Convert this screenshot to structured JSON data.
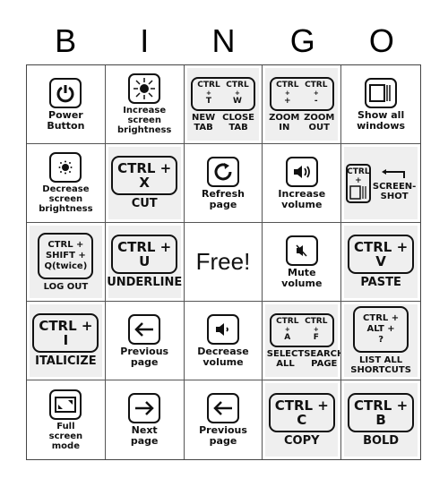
{
  "header": [
    "B",
    "I",
    "N",
    "G",
    "O"
  ],
  "cells": [
    {
      "type": "icon",
      "icon": "power-icon",
      "label": "Power\nButton"
    },
    {
      "type": "icon",
      "icon": "brightness-up-icon",
      "label": "Increase\nscreen\nbrightness"
    },
    {
      "type": "pair",
      "keys": [
        {
          "mod": "CTRL",
          "sep": "+",
          "key": "T"
        },
        {
          "mod": "CTRL",
          "sep": "+",
          "key": "W"
        }
      ],
      "labels": [
        "NEW\nTAB",
        "CLOSE\nTAB"
      ]
    },
    {
      "type": "pair",
      "keys": [
        {
          "mod": "CTRL",
          "sep": "+",
          "key": "+"
        },
        {
          "mod": "CTRL",
          "sep": "+",
          "key": "-"
        }
      ],
      "labels": [
        "ZOOM\nIN",
        "ZOOM\nOUT"
      ]
    },
    {
      "type": "icon",
      "icon": "show-windows-icon",
      "label": "Show all\nwindows"
    },
    {
      "type": "icon",
      "icon": "brightness-down-icon",
      "label": "Decrease\nscreen\nbrightness"
    },
    {
      "type": "key",
      "line1": "CTRL +",
      "line2": "X",
      "label": "CUT"
    },
    {
      "type": "icon",
      "icon": "refresh-icon",
      "label": "Refresh\npage"
    },
    {
      "type": "icon",
      "icon": "volume-up-icon",
      "label": "Increase\nvolume"
    },
    {
      "type": "screenshot",
      "mod": "CTRL",
      "sep": "+",
      "label": "SCREEN-\nSHOT"
    },
    {
      "type": "multi",
      "lines": [
        "CTRL +",
        "SHIFT +",
        "Q(twice)"
      ],
      "label": "LOG OUT"
    },
    {
      "type": "key",
      "line1": "CTRL +",
      "line2": "U",
      "label": "UNDERLINE"
    },
    {
      "type": "free",
      "label": "Free!"
    },
    {
      "type": "icon",
      "icon": "mute-icon",
      "label": "Mute\nvolume"
    },
    {
      "type": "key",
      "line1": "CTRL +",
      "line2": "V",
      "label": "PASTE"
    },
    {
      "type": "key",
      "line1": "CTRL +",
      "line2": "I",
      "label": "ITALICIZE"
    },
    {
      "type": "icon",
      "icon": "arrow-left-icon",
      "label": "Previous\npage"
    },
    {
      "type": "icon",
      "icon": "volume-down-icon",
      "label": "Decrease\nvolume"
    },
    {
      "type": "pair",
      "keys": [
        {
          "mod": "CTRL",
          "sep": "+",
          "key": "A"
        },
        {
          "mod": "CTRL",
          "sep": "+",
          "key": "F"
        }
      ],
      "labels": [
        "SELECT\nALL",
        "SEARCH\nPAGE"
      ]
    },
    {
      "type": "multi",
      "lines": [
        "CTRL +",
        "ALT +",
        "?"
      ],
      "label": "LIST ALL\nSHORTCUTS"
    },
    {
      "type": "icon",
      "icon": "fullscreen-icon",
      "label": "Full\nscreen\nmode"
    },
    {
      "type": "icon",
      "icon": "arrow-right-icon",
      "label": "Next\npage"
    },
    {
      "type": "icon",
      "icon": "arrow-left-icon",
      "label": "Previous\npage"
    },
    {
      "type": "key",
      "line1": "CTRL +",
      "line2": "C",
      "label": "COPY"
    },
    {
      "type": "key",
      "line1": "CTRL +",
      "line2": "B",
      "label": "BOLD"
    }
  ]
}
